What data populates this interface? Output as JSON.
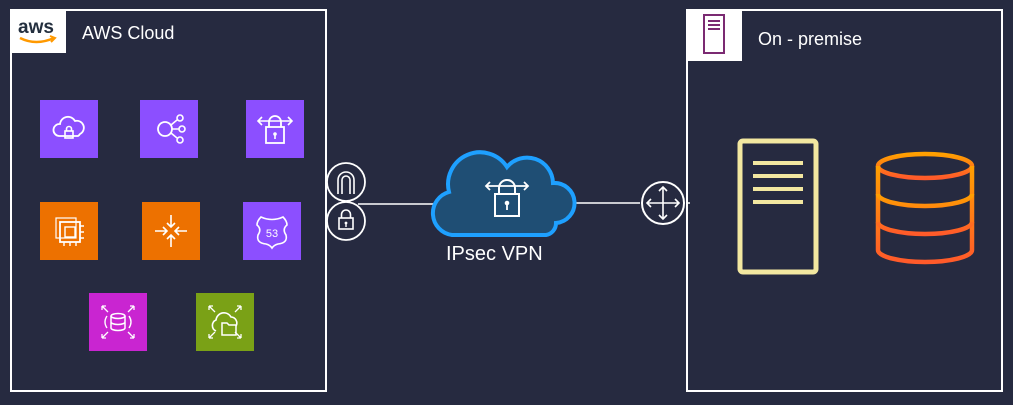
{
  "aws_group": {
    "title": "AWS Cloud",
    "logo_text": "aws",
    "services": [
      {
        "icon": "cloud-lock-icon",
        "color": "#8c4fff"
      },
      {
        "icon": "endpoints-icon",
        "color": "#8c4fff"
      },
      {
        "icon": "vpn-gateway-lock-icon",
        "color": "#8c4fff"
      },
      {
        "icon": "ec2-chip-icon",
        "color": "#ed7100"
      },
      {
        "icon": "load-arrows-icon",
        "color": "#ed7100"
      },
      {
        "icon": "route53-shield-icon",
        "color": "#8c4fff"
      },
      {
        "icon": "database-migration-icon",
        "color": "#c925d1"
      },
      {
        "icon": "cloud-folder-icon",
        "color": "#7aa116"
      }
    ],
    "route53_label": "53"
  },
  "onprem_group": {
    "title": "On - premise"
  },
  "connection": {
    "label": "IPsec VPN",
    "colors": {
      "cloud_fill": "#1f4e74",
      "cloud_stroke": "#1ea0ff",
      "server": "#f2e7a0",
      "database": "#ff7a00"
    }
  }
}
